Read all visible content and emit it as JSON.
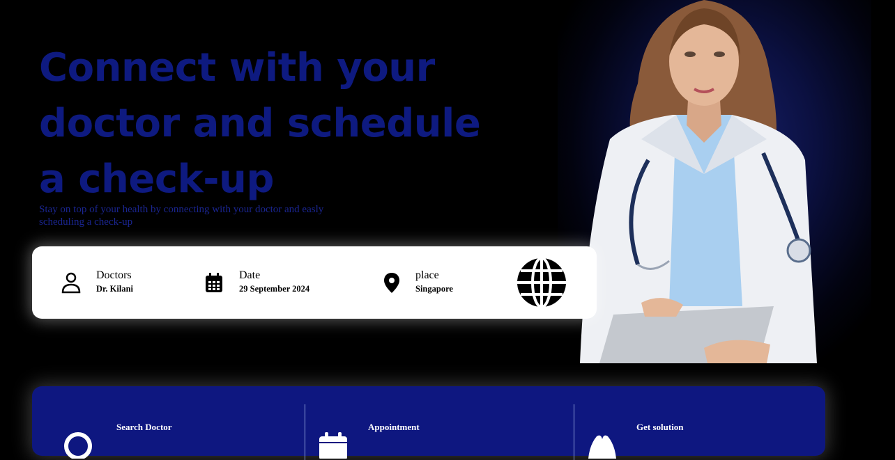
{
  "hero": {
    "title": "Connect with your doctor and schedule a check-up",
    "subtitle": "Stay on top of your health by connecting with your doctor and easly scheduling a check-up"
  },
  "search": {
    "doctor": {
      "label": "Doctors",
      "value": "Dr. Kilani",
      "icon": "user-icon"
    },
    "date": {
      "label": "Date",
      "value": "29 September 2024",
      "icon": "calendar-icon"
    },
    "place": {
      "label": "place",
      "value": "Singapore",
      "icon": "location-pin-icon"
    },
    "action_icon": "globe-icon"
  },
  "features": [
    {
      "title": "Search Doctor",
      "icon": "search-icon"
    },
    {
      "title": "Appointment",
      "icon": "calendar-icon"
    },
    {
      "title": "Get solution",
      "icon": "hands-icon"
    }
  ],
  "colors": {
    "background": "#000000",
    "heading": "#0e1a80",
    "features_panel": "#0e1780",
    "card": "#ffffff"
  }
}
